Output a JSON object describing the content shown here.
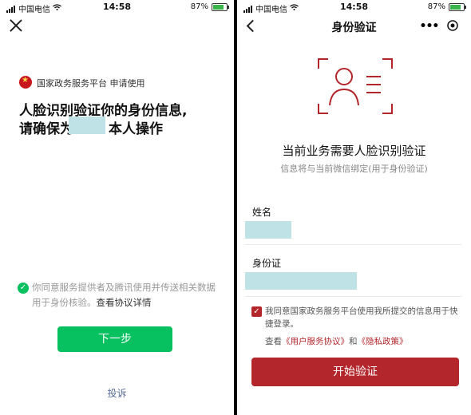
{
  "status": {
    "carrier": "中国电信",
    "time": "14:58",
    "battery": "87%"
  },
  "left": {
    "org": "国家政务服务平台 申请使用",
    "headline1": "人脸识别验证你的身份信息,",
    "headline2_pre": "请确保为",
    "headline2_post": "本人操作",
    "agree_text": "你同意服务提供者及腾讯使用并传送相关数据用于身份核验。",
    "agree_link": "查看协议详情",
    "next_button": "下一步",
    "complaint": "投诉"
  },
  "right": {
    "title": "身份验证",
    "heading": "当前业务需要人脸识别验证",
    "subheading": "信息将与当前微信绑定(用于身份验证)",
    "name_label": "姓名",
    "id_label": "身份证",
    "consent": "我同意国家政务服务平台使用我所提交的信息用于快捷登录。",
    "view_pre": "查看",
    "link1": "《用户服务协议》",
    "and": "和",
    "link2": "《隐私政策》",
    "start_button": "开始验证"
  },
  "colors": {
    "green": "#07c160",
    "red": "#b3262b",
    "mask": "#bfe2e6"
  },
  "icons": [
    "signal-icon",
    "wifi-icon",
    "battery-icon",
    "close-icon",
    "emblem-icon",
    "check-icon",
    "back-icon",
    "more-icon",
    "record-icon",
    "face-scan-icon",
    "checkbox-icon"
  ]
}
